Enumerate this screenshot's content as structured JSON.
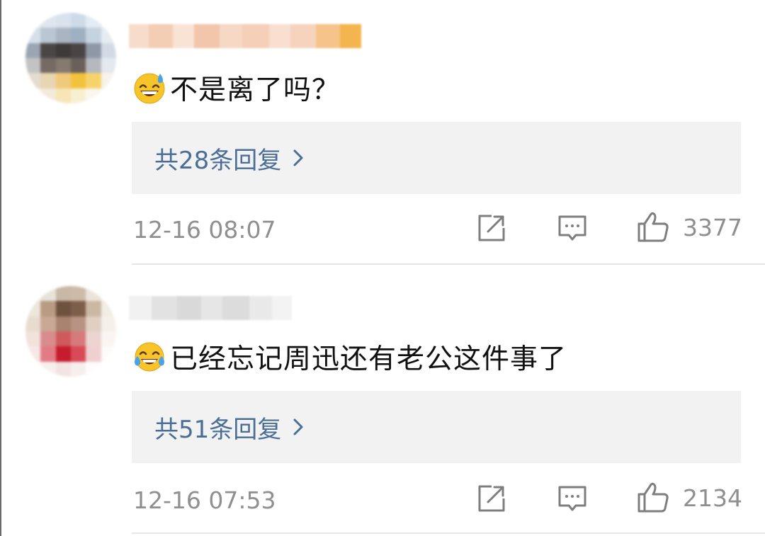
{
  "comments": [
    {
      "text": "不是离了吗？",
      "emoji": "sweat-smile-emoji",
      "replies_label": "共28条回复",
      "timestamp": "12-16 08:07",
      "likes": "3377"
    },
    {
      "text": "已经忘记周迅还有老公这件事了",
      "emoji": "tears-of-joy-emoji",
      "replies_label": "共51条回复",
      "timestamp": "12-16 07:53",
      "likes": "2134"
    }
  ],
  "icons": {
    "repost": "share-out-icon",
    "comment": "comment-bubble-icon",
    "like": "thumbs-up-icon",
    "chevron": "chevron-right-icon"
  },
  "colors": {
    "reply_link": "#4b6e98",
    "meta_text": "#8f8f8f",
    "reply_box_bg": "#f2f2f2",
    "comment_text": "#111111"
  }
}
